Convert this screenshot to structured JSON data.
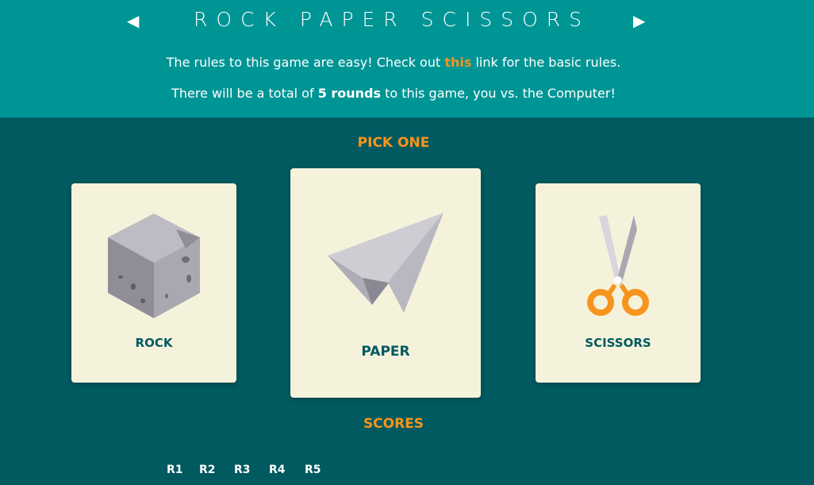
{
  "header": {
    "title": "ROCK PAPER SCISSORS",
    "left_arrow": "◀",
    "right_arrow": "▶",
    "rules_before": "The rules to this game are easy! Check out ",
    "rules_link": "this",
    "rules_after": " link for the basic rules.",
    "rounds_before": "There will be a total of ",
    "rounds_bold": "5 rounds",
    "rounds_after": " to this game, you vs. the Computer!"
  },
  "pick": {
    "heading": "PICK ONE",
    "choices": [
      {
        "label": "ROCK",
        "icon": "rock-icon"
      },
      {
        "label": "PAPER",
        "icon": "paper-plane-icon"
      },
      {
        "label": "SCISSORS",
        "icon": "scissors-icon"
      }
    ]
  },
  "scores": {
    "heading": "SCORES",
    "rounds": [
      "R1",
      "R2",
      "R3",
      "R4",
      "R5"
    ]
  },
  "colors": {
    "header_bg": "#009595",
    "body_bg": "#005a5f",
    "accent": "#f7941d",
    "card_bg": "#f5f2dc"
  }
}
